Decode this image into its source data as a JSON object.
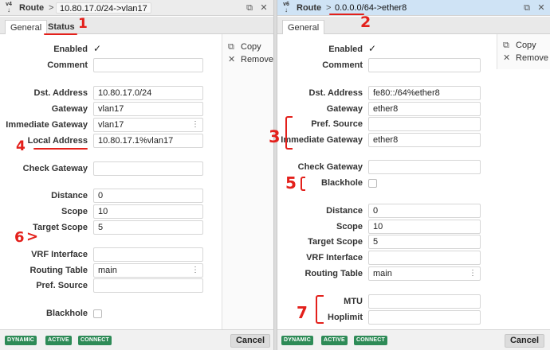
{
  "colors": {
    "accent_red": "#e3201b",
    "badge_green": "#2e8b57",
    "title_active": "#cfe3f5"
  },
  "left": {
    "title": {
      "icon_text": "v4",
      "crumb": "Route",
      "sep": ">",
      "path": "10.80.17.0/24->vlan17"
    },
    "tabs": [
      "General",
      "Status"
    ],
    "side_buttons": [
      "Copy",
      "Remove"
    ],
    "fields": {
      "enabled_label": "Enabled",
      "comment_label": "Comment",
      "dst_label": "Dst. Address",
      "dst_value": "10.80.17.0/24",
      "gateway_label": "Gateway",
      "gateway_value": "vlan17",
      "imm_gateway_label": "Immediate Gateway",
      "imm_gateway_value": "vlan17",
      "local_label": "Local Address",
      "local_value": "10.80.17.1%vlan17",
      "check_gateway_label": "Check Gateway",
      "distance_label": "Distance",
      "distance_value": "0",
      "scope_label": "Scope",
      "scope_value": "10",
      "target_scope_label": "Target Scope",
      "target_scope_value": "5",
      "vrf_label": "VRF Interface",
      "routing_table_label": "Routing Table",
      "routing_table_value": "main",
      "pref_source_label": "Pref. Source",
      "blackhole_label": "Blackhole"
    },
    "badges": [
      "DYNAMIC",
      "ACTIVE",
      "CONNECT"
    ],
    "cancel": "Cancel"
  },
  "right": {
    "title": {
      "icon_text": "v6",
      "crumb": "Route",
      "sep": ">",
      "path": "0.0.0.0/64->ether8"
    },
    "tabs": [
      "General"
    ],
    "side_buttons": [
      "Copy",
      "Remove"
    ],
    "fields": {
      "enabled_label": "Enabled",
      "comment_label": "Comment",
      "dst_label": "Dst. Address",
      "dst_value": "fe80::/64%ether8",
      "gateway_label": "Gateway",
      "gateway_value": "ether8",
      "pref_source_label": "Pref. Source",
      "imm_gateway_label": "Immediate Gateway",
      "imm_gateway_value": "ether8",
      "check_gateway_label": "Check Gateway",
      "blackhole_label": "Blackhole",
      "distance_label": "Distance",
      "distance_value": "0",
      "scope_label": "Scope",
      "scope_value": "10",
      "target_scope_label": "Target Scope",
      "target_scope_value": "5",
      "vrf_label": "VRF Interface",
      "routing_table_label": "Routing Table",
      "routing_table_value": "main",
      "mtu_label": "MTU",
      "hoplimit_label": "Hoplimit"
    },
    "badges": [
      "DYNAMIC",
      "ACTIVE",
      "CONNECT"
    ],
    "cancel": "Cancel"
  },
  "annotations": [
    "1",
    "2",
    "3",
    "4",
    "5",
    "6",
    "7"
  ]
}
